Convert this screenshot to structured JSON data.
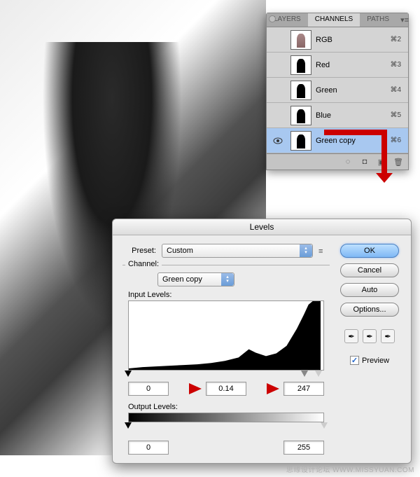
{
  "watermark": "思缘设计论坛  WWW.MISSYUAN.COM",
  "channels_panel": {
    "tabs": [
      {
        "label": "LAYERS",
        "active": false
      },
      {
        "label": "CHANNELS",
        "active": true
      },
      {
        "label": "PATHS",
        "active": false
      }
    ],
    "rows": [
      {
        "eye": false,
        "name": "RGB",
        "shortcut": "⌘2",
        "selected": false,
        "variant": "color"
      },
      {
        "eye": false,
        "name": "Red",
        "shortcut": "⌘3",
        "selected": false,
        "variant": "bw"
      },
      {
        "eye": false,
        "name": "Green",
        "shortcut": "⌘4",
        "selected": false,
        "variant": "bw"
      },
      {
        "eye": false,
        "name": "Blue",
        "shortcut": "⌘5",
        "selected": false,
        "variant": "bw"
      },
      {
        "eye": true,
        "name": "Green copy",
        "shortcut": "⌘6",
        "selected": true,
        "variant": "bw"
      }
    ]
  },
  "levels": {
    "title": "Levels",
    "preset_label": "Preset:",
    "preset_value": "Custom",
    "channel_label": "Channel:",
    "channel_value": "Green copy",
    "input_label": "Input Levels:",
    "input_values": {
      "black": "0",
      "mid": "0.14",
      "white": "247"
    },
    "output_label": "Output Levels:",
    "output_values": {
      "black": "0",
      "white": "255"
    },
    "buttons": {
      "ok": "OK",
      "cancel": "Cancel",
      "auto": "Auto",
      "options": "Options..."
    },
    "preview_label": "Preview",
    "preview_checked": true
  }
}
